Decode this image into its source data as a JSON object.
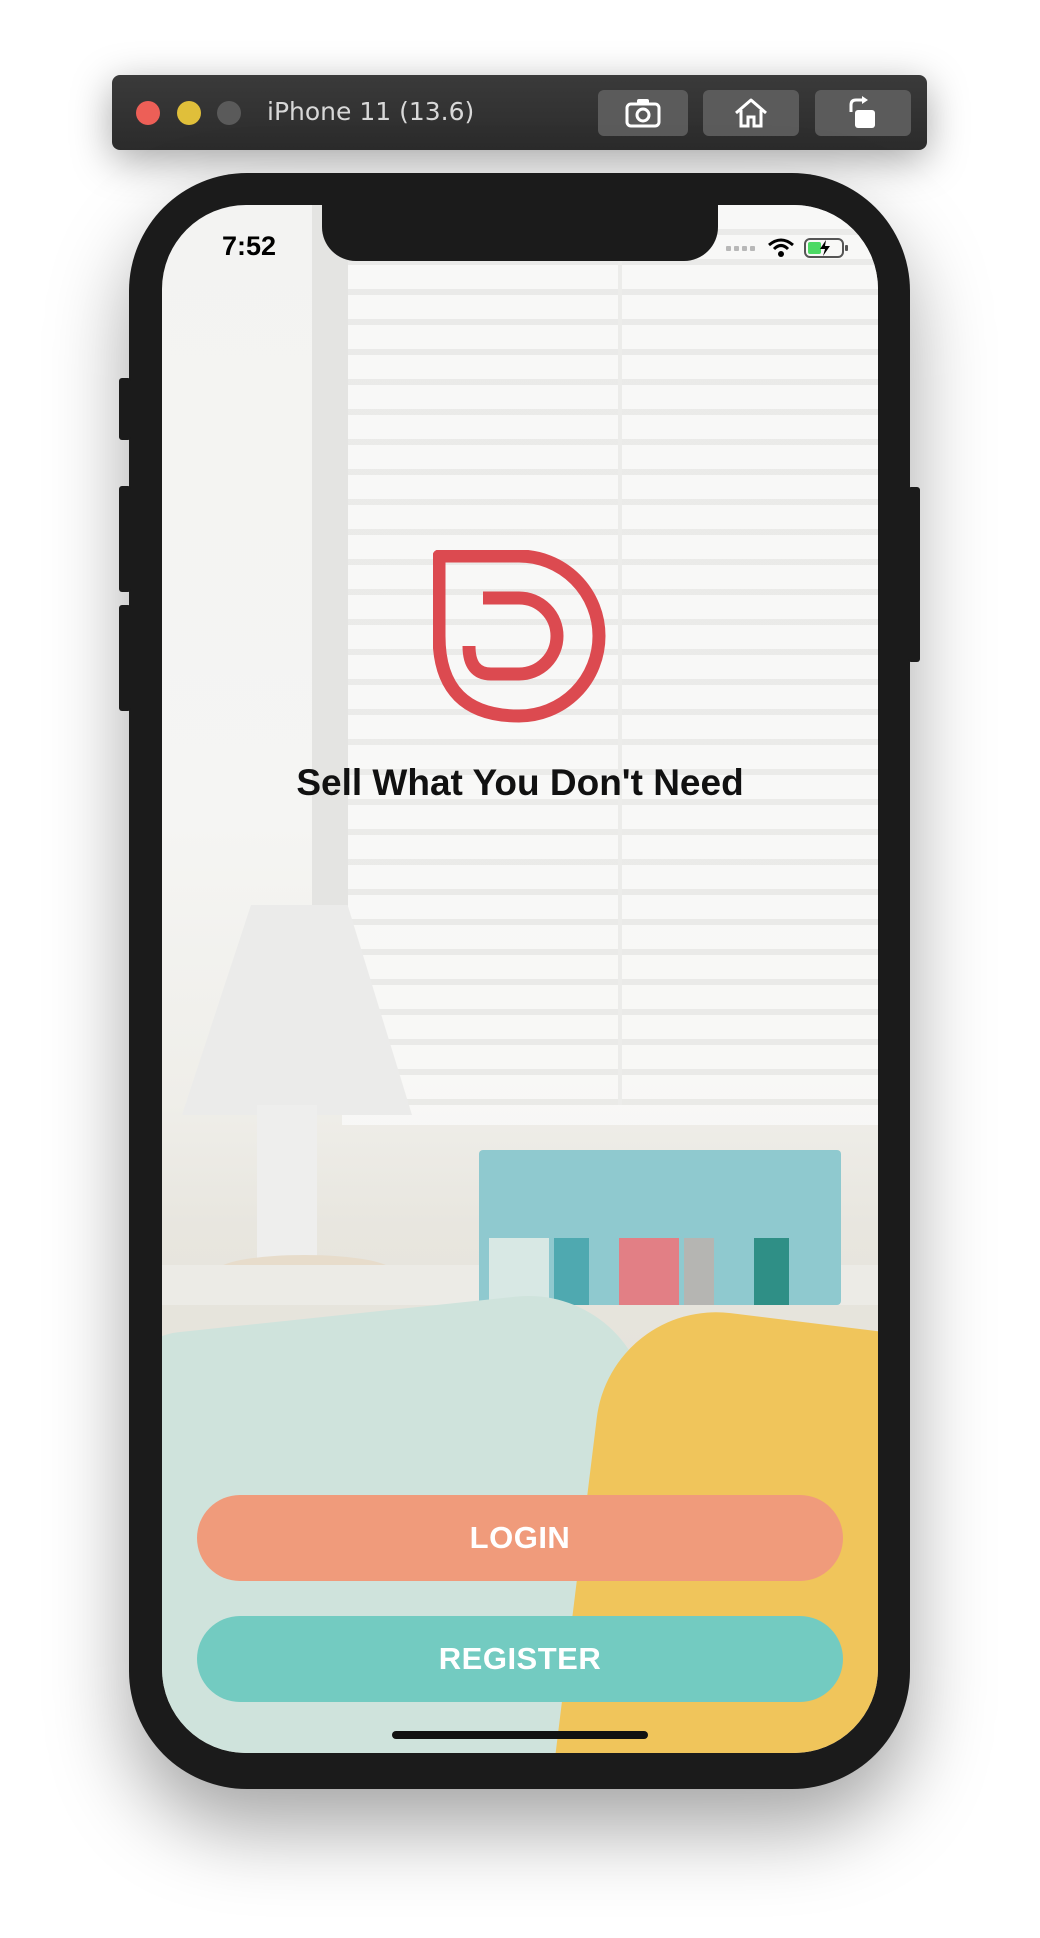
{
  "simulator": {
    "title": "iPhone 11 (13.6)",
    "buttons": [
      {
        "icon": "camera-icon"
      },
      {
        "icon": "home-icon"
      },
      {
        "icon": "rotate-icon"
      }
    ]
  },
  "status_bar": {
    "time": "7:52",
    "icons": [
      "signal-icon",
      "wifi-icon",
      "battery-charging-icon"
    ]
  },
  "hero": {
    "logo_icon": "d-logo-icon",
    "tagline": "Sell What You Don't Need"
  },
  "actions": {
    "login_label": "LOGIN",
    "register_label": "REGISTER"
  },
  "colors": {
    "brand_red": "#dc4a50",
    "login_bg": "#f09b7b",
    "register_bg": "#73cbc1"
  }
}
